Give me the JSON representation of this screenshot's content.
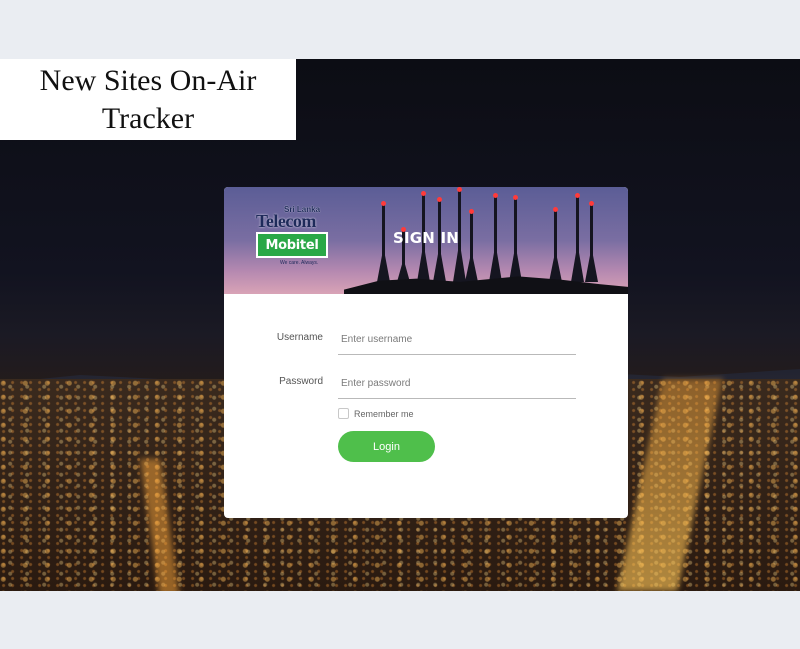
{
  "page": {
    "title_line1": "New Sites On-Air",
    "title_line2": "Tracker"
  },
  "brand": {
    "region": "Sri Lanka",
    "company": "Telecom",
    "product": "Mobitel",
    "tagline": "We care. Always.",
    "accent_color": "#4fbf4b"
  },
  "login": {
    "heading": "SIGN IN",
    "username": {
      "label": "Username",
      "placeholder": "Enter username",
      "value": ""
    },
    "password": {
      "label": "Password",
      "placeholder": "Enter password",
      "value": ""
    },
    "remember_label": "Remember me",
    "remember_checked": false,
    "submit_label": "Login"
  }
}
